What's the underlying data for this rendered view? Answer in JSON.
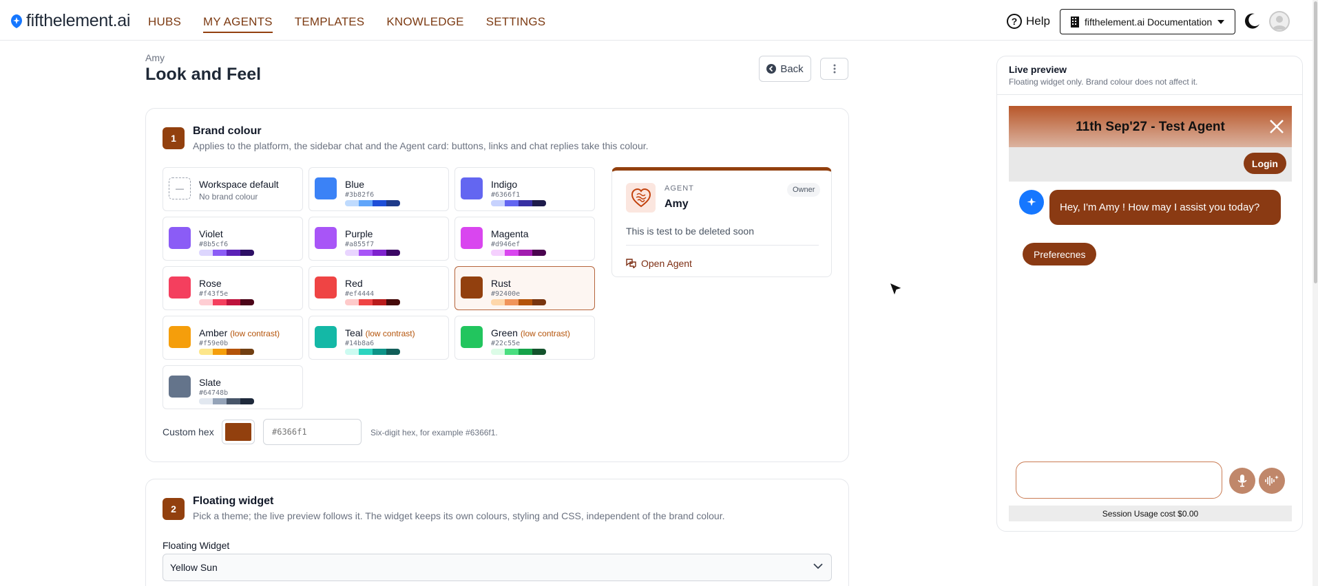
{
  "brand": {
    "name": "fifthelement.ai",
    "accent": "#92400e"
  },
  "nav": {
    "items": [
      {
        "label": "HUBS"
      },
      {
        "label": "MY AGENTS"
      },
      {
        "label": "TEMPLATES"
      },
      {
        "label": "KNOWLEDGE"
      },
      {
        "label": "SETTINGS"
      }
    ],
    "active": "MY AGENTS",
    "help_label": "Help",
    "docs_label": "fifthelement.ai Documentation"
  },
  "page": {
    "breadcrumb": "Amy",
    "title": "Look and Feel",
    "back_label": "Back",
    "more_icon": "vertical-ellipsis-icon"
  },
  "brand_colour_section": {
    "step": "1",
    "title": "Brand colour",
    "description": "Applies to the platform, the sidebar chat and the Agent card: buttons, links and chat replies take this colour.",
    "swatches": [
      {
        "name": "Workspace default",
        "sub": "No brand colour",
        "chip": "—",
        "hex": "",
        "color": ""
      },
      {
        "name": "Blue",
        "hex": "#3b82f6",
        "color": "#3b82f6",
        "scale": [
          "#bfdbfe",
          "#60a5fa",
          "#1d4ed8",
          "#1e3a8a"
        ]
      },
      {
        "name": "Indigo",
        "hex": "#6366f1",
        "color": "#6366f1",
        "scale": [
          "#c7d2fe",
          "#6366f1",
          "#3730a3",
          "#1e1b4b"
        ]
      },
      {
        "name": "Violet",
        "hex": "#8b5cf6",
        "color": "#8b5cf6",
        "scale": [
          "#ddd6fe",
          "#8b5cf6",
          "#5b21b6",
          "#2e1065"
        ]
      },
      {
        "name": "Purple",
        "hex": "#a855f7",
        "color": "#a855f7",
        "scale": [
          "#e9d5ff",
          "#a855f7",
          "#7e22ce",
          "#3b0764"
        ]
      },
      {
        "name": "Magenta",
        "hex": "#d946ef",
        "color": "#d946ef",
        "scale": [
          "#f5d0fe",
          "#d946ef",
          "#a21caf",
          "#4a044e"
        ]
      },
      {
        "name": "Rose",
        "hex": "#f43f5e",
        "color": "#f43f5e",
        "scale": [
          "#fecdd3",
          "#f43f5e",
          "#be123c",
          "#4c0519"
        ]
      },
      {
        "name": "Red",
        "hex": "#ef4444",
        "color": "#ef4444",
        "scale": [
          "#fecaca",
          "#ef4444",
          "#b91c1c",
          "#450a0a"
        ]
      },
      {
        "name": "Rust",
        "hex": "#92400e",
        "color": "#92400e",
        "selected": true,
        "scale": [
          "#fed7aa",
          "#f0945a",
          "#b45309",
          "#78350f"
        ]
      },
      {
        "name": "Amber",
        "note": "(low contrast)",
        "hex": "#f59e0b",
        "color": "#f59e0b",
        "scale": [
          "#fde68a",
          "#f59e0b",
          "#b45309",
          "#713f12"
        ]
      },
      {
        "name": "Teal",
        "note": "(low contrast)",
        "hex": "#14b8a6",
        "color": "#14b8a6",
        "scale": [
          "#ccfbf1",
          "#2dd4bf",
          "#0d9488",
          "#115e59"
        ]
      },
      {
        "name": "Green",
        "note": "(low contrast)",
        "hex": "#22c55e",
        "color": "#22c55e",
        "scale": [
          "#dcfce7",
          "#4ade80",
          "#16a34a",
          "#14532d"
        ]
      },
      {
        "name": "Slate",
        "hex": "#64748b",
        "color": "#64748b",
        "scale": [
          "#e2e8f0",
          "#94a3b8",
          "#475569",
          "#1e293b"
        ]
      }
    ],
    "custom_label": "Custom hex",
    "custom_color": "#92400e",
    "custom_placeholder": "#6366f1",
    "custom_help": "Six-digit hex, for example #6366f1."
  },
  "agent_card": {
    "kicker": "AGENT",
    "name": "Amy",
    "badge": "Owner",
    "description": "This is test to be deleted soon",
    "open_label": "Open Agent",
    "icon": "brain-heart-icon"
  },
  "floating_widget_section": {
    "step": "2",
    "title": "Floating widget",
    "description": "Pick a theme; the live preview follows it. The widget keeps its own colours, styling and CSS, independent of the brand colour.",
    "field_label": "Floating Widget",
    "selected": "Yellow Sun"
  },
  "preview": {
    "title": "Live preview",
    "subtitle": "Floating widget only. Brand colour does not affect it.",
    "widget_title": "11th Sep'27 - Test Agent",
    "login_label": "Login",
    "bot_message": "Hey, I'm Amy ! How may I assist you today?",
    "chip_label": "Preferecnes",
    "usage_text": "Session Usage cost $0.00"
  }
}
